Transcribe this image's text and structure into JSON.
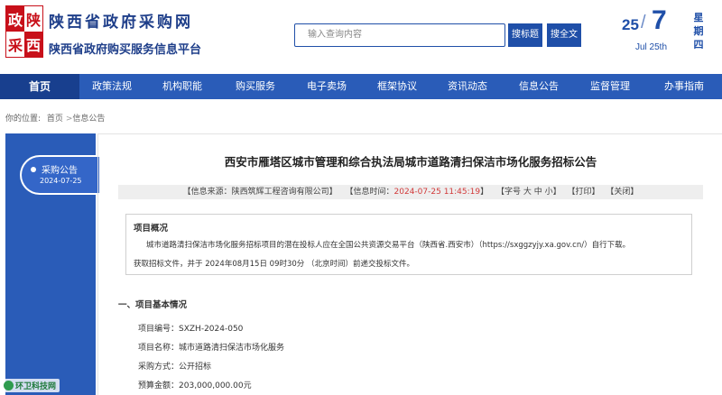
{
  "header": {
    "logo_chars": [
      "政",
      "陕",
      "采",
      "西"
    ],
    "site_title": "陕西省政府采购网",
    "site_subtitle": "陕西省政府购买服务信息平台",
    "search_placeholder": "输入查询内容",
    "search_title_btn": "搜标题",
    "search_full_btn": "搜全文",
    "date_day": "25",
    "date_slash": "/",
    "date_month": "7",
    "date_en": "Jul 25th",
    "weekday": [
      "星",
      "期",
      "四"
    ]
  },
  "nav": {
    "items": [
      {
        "label": "首页",
        "active": true
      },
      {
        "label": "政策法规",
        "active": false
      },
      {
        "label": "机构职能",
        "active": false
      },
      {
        "label": "购买服务",
        "active": false
      },
      {
        "label": "电子卖场",
        "active": false
      },
      {
        "label": "框架协议",
        "active": false
      },
      {
        "label": "资讯动态",
        "active": false
      },
      {
        "label": "信息公告",
        "active": false
      },
      {
        "label": "监督管理",
        "active": false
      },
      {
        "label": "办事指南",
        "active": false
      }
    ]
  },
  "breadcrumb": {
    "prefix": "你的位置:",
    "home": "首页",
    "separator": ">",
    "current": "信息公告"
  },
  "sidebar": {
    "tab_label": "采购公告",
    "tab_date": "2024-07-25"
  },
  "watermark": "环卫科技网",
  "article": {
    "title": "西安市雁塔区城市管理和综合执法局城市道路清扫保洁市场化服务招标公告",
    "meta": {
      "source_prefix": "【信息来源：",
      "source": "陕西筑辉工程咨询有限公司",
      "source_suffix": "】",
      "time_prefix": "【信息时间：",
      "time": "2024-07-25 11:45:19",
      "time_suffix": "】",
      "font_size": "【字号 大 中 小】",
      "print": "【打印】",
      "close": "【关闭】"
    },
    "overview": {
      "title": "项目概况",
      "line1": "城市道路清扫保洁市场化服务招标项目的潜在投标人应在全国公共资源交易平台（陕西省.西安市）（https://sxggzyjy.xa.gov.cn/）自行下载。",
      "line2": "获取招标文件，并于 2024年08月15日 09时30分 （北京时间）前递交投标文件。"
    },
    "section1_title": "一、项目基本情况",
    "fields": [
      {
        "label": "项目编号：",
        "value": "SXZH-2024-050"
      },
      {
        "label": "项目名称：",
        "value": "城市道路清扫保洁市场化服务"
      },
      {
        "label": "采购方式：",
        "value": "公开招标"
      },
      {
        "label": "预算金额：",
        "value": "203,000,000.00元"
      }
    ]
  },
  "colors": {
    "brand_blue": "#2a5cb8",
    "nav_active": "#183f8e",
    "logo_red": "#c8101a",
    "meta_red": "#d23a3a"
  }
}
